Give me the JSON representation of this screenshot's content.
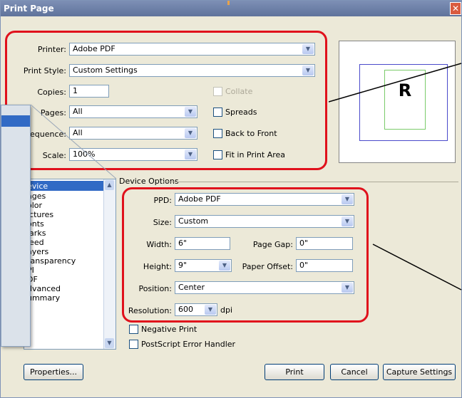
{
  "window": {
    "title": "Print Page",
    "close_glyph": "✕"
  },
  "general": {
    "printer_label": "Printer:",
    "printer_value": "Adobe PDF",
    "style_label": "Print Style:",
    "style_value": "Custom Settings",
    "copies_label": "Copies:",
    "copies_value": "1",
    "collate_label": "Collate",
    "pages_label": "Pages:",
    "pages_value": "All",
    "spreads_label": "Spreads",
    "sequence_label": "equence:",
    "sequence_value": "All",
    "back_to_front_label": "Back to Front",
    "scale_label": "Scale:",
    "scale_value": "100%",
    "fit_label": "Fit in Print Area"
  },
  "preview": {
    "letter": "R",
    "help_glyph": "?"
  },
  "categories": {
    "items": [
      "evice",
      "ages",
      "olor",
      "ictures",
      "onts",
      "larks",
      "leed",
      "ayers",
      "ransparency",
      "PI",
      "DF",
      "dvanced",
      "ummary"
    ],
    "selected_index": 0,
    "popup_selected": ""
  },
  "device_options": {
    "title": "Device Options",
    "ppd_label": "PPD:",
    "ppd_value": "Adobe PDF",
    "size_label": "Size:",
    "size_value": "Custom",
    "width_label": "Width:",
    "width_value": "6\"",
    "page_gap_label": "Page Gap:",
    "page_gap_value": "0\"",
    "height_label": "Height:",
    "height_value": "9\"",
    "paper_offset_label": "Paper Offset:",
    "paper_offset_value": "0\"",
    "position_label": "Position:",
    "position_value": "Center",
    "resolution_label": "Resolution:",
    "resolution_value": "600",
    "dpi_label": "dpi",
    "negative_label": "Negative Print",
    "ps_error_label": "PostScript Error Handler"
  },
  "buttons": {
    "properties": "Properties...",
    "print": "Print",
    "cancel": "Cancel",
    "capture": "Capture Settings"
  },
  "colors": {
    "highlight_red": "#e0111c",
    "title_bar": "#6c80a8",
    "selection_blue": "#316ac5"
  }
}
